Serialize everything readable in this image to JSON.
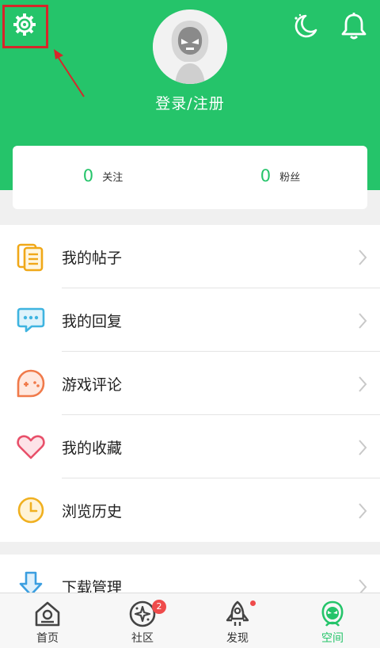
{
  "header": {
    "login_text": "登录/注册",
    "icons": [
      "gear-icon",
      "moon-icon",
      "bell-icon"
    ],
    "bg_color": "#25c46a"
  },
  "stats": {
    "following": {
      "count": "0",
      "label": "关注"
    },
    "followers": {
      "count": "0",
      "label": "粉丝"
    }
  },
  "menu": {
    "items": [
      {
        "label": "我的帖子",
        "icon": "posts-icon"
      },
      {
        "label": "我的回复",
        "icon": "reply-icon"
      },
      {
        "label": "游戏评论",
        "icon": "game-review-icon"
      },
      {
        "label": "我的收藏",
        "icon": "favorites-icon"
      },
      {
        "label": "浏览历史",
        "icon": "history-icon"
      }
    ]
  },
  "menu2": {
    "items": [
      {
        "label": "下载管理",
        "icon": "download-icon"
      }
    ]
  },
  "tabbar": {
    "tabs": [
      {
        "label": "首页",
        "icon": "home-icon"
      },
      {
        "label": "社区",
        "icon": "community-icon",
        "badge": "2"
      },
      {
        "label": "发现",
        "icon": "rocket-icon"
      },
      {
        "label": "空间",
        "icon": "space-icon"
      }
    ],
    "active_color": "#25c46a",
    "badge_color": "#ef4b4b"
  }
}
